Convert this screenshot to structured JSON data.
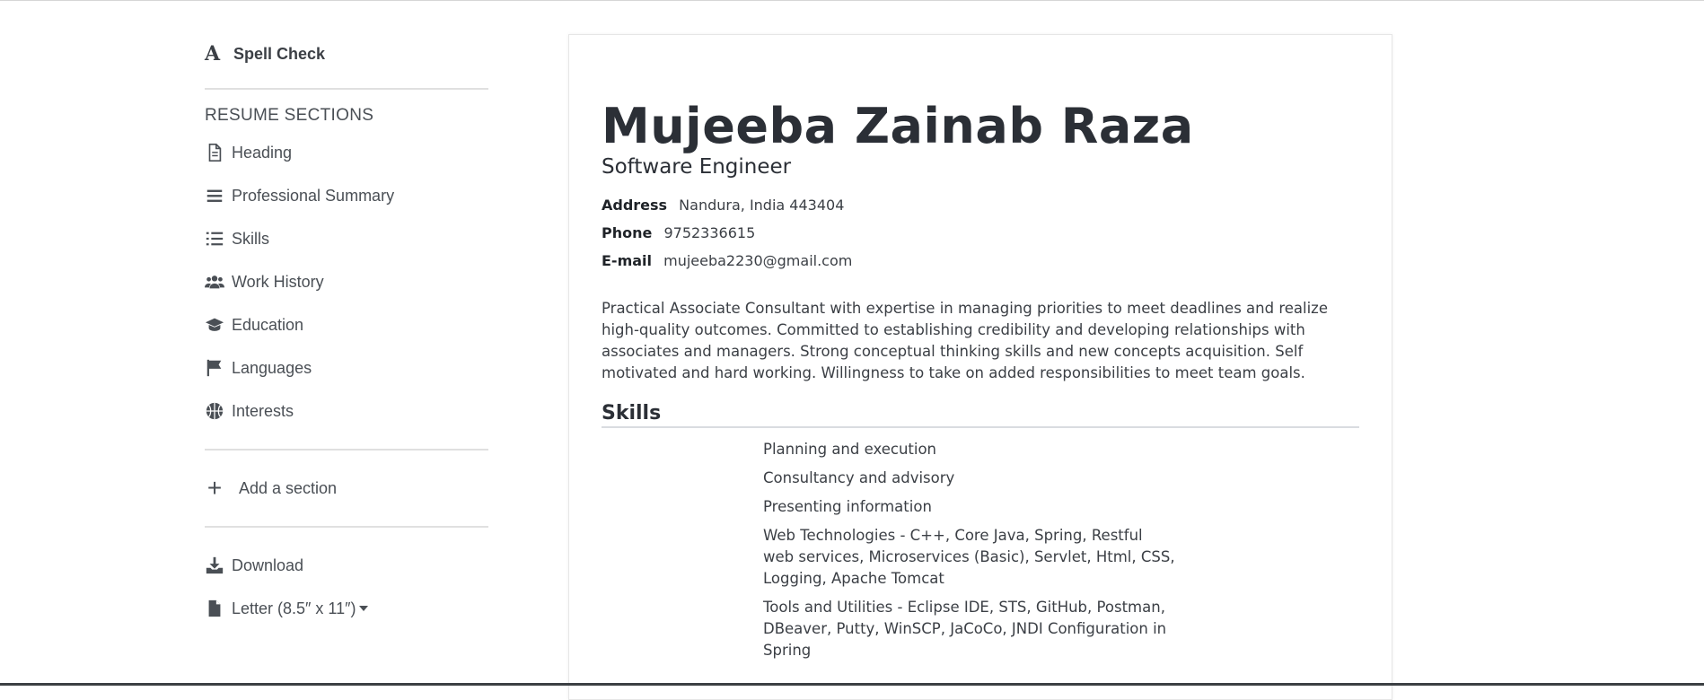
{
  "sidebar": {
    "spell_check": {
      "glyph": "A",
      "label": "Spell Check"
    },
    "sections_title": "RESUME SECTIONS",
    "items": [
      {
        "label": "Heading",
        "icon": "document-icon"
      },
      {
        "label": "Professional Summary",
        "icon": "lines-icon"
      },
      {
        "label": "Skills",
        "icon": "list-icon"
      },
      {
        "label": "Work History",
        "icon": "users-icon"
      },
      {
        "label": "Education",
        "icon": "graduation-cap-icon"
      },
      {
        "label": "Languages",
        "icon": "flag-icon"
      },
      {
        "label": "Interests",
        "icon": "basketball-icon"
      }
    ],
    "add_section": {
      "symbol": "+",
      "label": "Add a section"
    },
    "download": {
      "label": "Download"
    },
    "paper_size": {
      "label": "Letter (8.5″ x 11″)"
    }
  },
  "resume": {
    "name": "Mujeeba Zainab Raza",
    "title": "Software Engineer",
    "contact": {
      "address_label": "Address",
      "address": "Nandura, India 443404",
      "phone_label": "Phone",
      "phone": "9752336615",
      "email_label": "E-mail",
      "email": "mujeeba2230@gmail.com"
    },
    "summary": "Practical Associate Consultant with expertise in managing priorities to meet deadlines and realize high-quality outcomes. Committed to establishing credibility and developing relationships with associates and managers. Strong conceptual thinking skills and new concepts acquisition. Self motivated and hard working. Willingness to take on added responsibilities to meet team goals.",
    "skills_title": "Skills",
    "skills": [
      "Planning and execution",
      "Consultancy and advisory",
      "Presenting information",
      "Web Technologies - C++, Core Java, Spring, Restful web services, Microservices (Basic), Servlet, Html, CSS, Logging, Apache Tomcat",
      "Tools and Utilities - Eclipse IDE, STS, GitHub, Postman, DBeaver, Putty, WinSCP, JaCoCo, JNDI Configuration in Spring"
    ]
  }
}
